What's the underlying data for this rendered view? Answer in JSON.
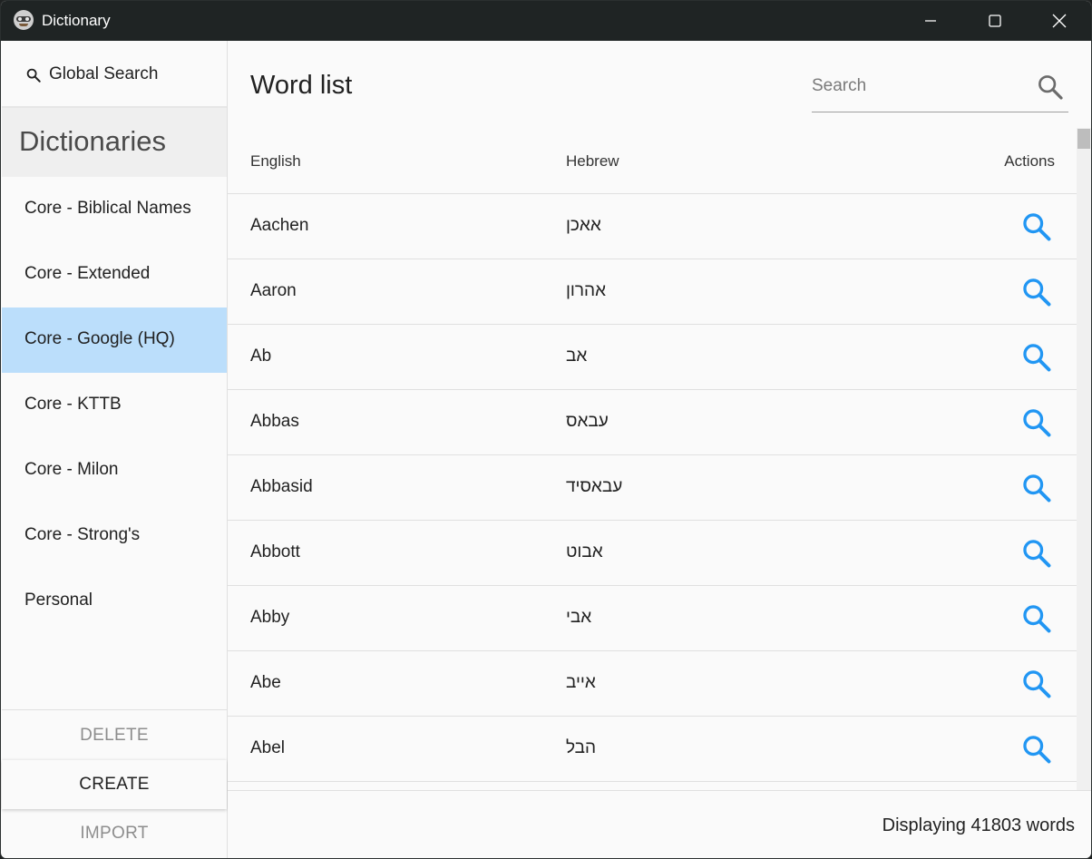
{
  "window": {
    "title": "Dictionary"
  },
  "sidebar": {
    "global_search_label": "Global Search",
    "header": "Dictionaries",
    "items": [
      {
        "label": "Core - Biblical Names",
        "selected": false
      },
      {
        "label": "Core - Extended",
        "selected": false
      },
      {
        "label": "Core - Google (HQ)",
        "selected": true
      },
      {
        "label": "Core - KTTB",
        "selected": false
      },
      {
        "label": "Core - Milon",
        "selected": false
      },
      {
        "label": "Core - Strong's",
        "selected": false
      },
      {
        "label": "Personal",
        "selected": false
      }
    ],
    "buttons": {
      "delete": "DELETE",
      "create": "CREATE",
      "import": "IMPORT"
    }
  },
  "main": {
    "title": "Word list",
    "search": {
      "placeholder": "Search",
      "value": ""
    },
    "table": {
      "headers": {
        "english": "English",
        "hebrew": "Hebrew",
        "actions": "Actions"
      },
      "rows": [
        {
          "english": "Aachen",
          "hebrew": "אאכן"
        },
        {
          "english": "Aaron",
          "hebrew": "אהרון"
        },
        {
          "english": "Ab",
          "hebrew": "אב"
        },
        {
          "english": "Abbas",
          "hebrew": "עבאס"
        },
        {
          "english": "Abbasid",
          "hebrew": "עבאסיד"
        },
        {
          "english": "Abbott",
          "hebrew": "אבוט"
        },
        {
          "english": "Abby",
          "hebrew": "אבי"
        },
        {
          "english": "Abe",
          "hebrew": "אייב"
        },
        {
          "english": "Abel",
          "hebrew": "הבל"
        }
      ],
      "action_icon": "search-icon"
    },
    "footer": "Displaying 41803 words"
  },
  "colors": {
    "titlebar": "#1f2424",
    "selected_item": "#bbdefb",
    "action_icon": "#2196f3"
  }
}
